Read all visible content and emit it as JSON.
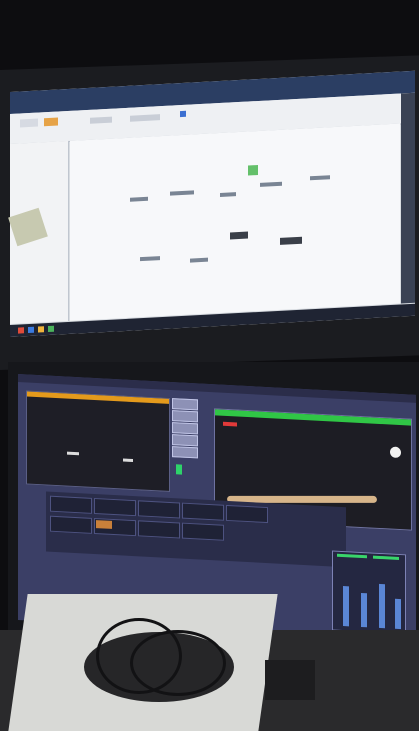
{
  "scene": {
    "description_free": true,
    "upper_monitor": {
      "app": "flowchart-editor",
      "accent": "#2b3e63",
      "canvas_color": "#f7f8fa"
    },
    "lower_monitor": {
      "app": "video-playout-console",
      "accent_orange": "#e49a1c",
      "accent_green": "#30c646",
      "background": "#3b3f66"
    }
  }
}
